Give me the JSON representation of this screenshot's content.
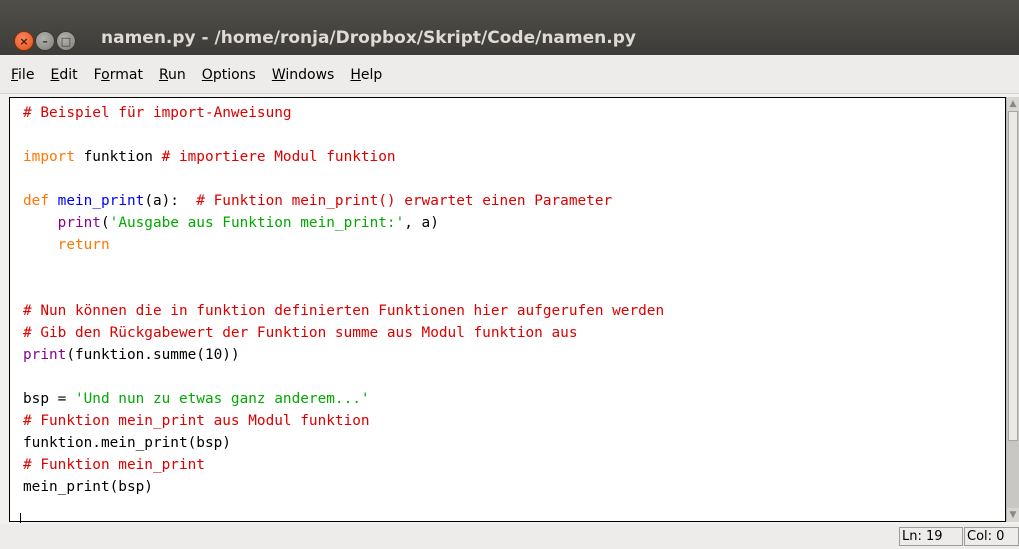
{
  "window": {
    "title": "namen.py - /home/ronja/Dropbox/Skript/Code/namen.py",
    "close_glyph": "×",
    "min_glyph": "–",
    "max_glyph": "□"
  },
  "menubar": {
    "items": [
      {
        "mnemonic": "F",
        "rest": "ile"
      },
      {
        "mnemonic": "E",
        "rest": "dit"
      },
      {
        "pre": "F",
        "mnemonic": "o",
        "rest": "rmat"
      },
      {
        "mnemonic": "R",
        "rest": "un"
      },
      {
        "mnemonic": "O",
        "rest": "ptions"
      },
      {
        "mnemonic": "W",
        "rest": "indows"
      },
      {
        "mnemonic": "H",
        "rest": "elp"
      }
    ]
  },
  "editor": {
    "lines": [
      [
        {
          "t": "comment",
          "s": "# Beispiel für import-Anweisung"
        }
      ],
      [],
      [
        {
          "t": "keyword",
          "s": "import"
        },
        {
          "t": "normal",
          "s": " funktion "
        },
        {
          "t": "comment",
          "s": "# importiere Modul funktion"
        }
      ],
      [],
      [
        {
          "t": "keyword",
          "s": "def"
        },
        {
          "t": "normal",
          "s": " "
        },
        {
          "t": "def",
          "s": "mein_print"
        },
        {
          "t": "normal",
          "s": "(a):  "
        },
        {
          "t": "comment",
          "s": "# Funktion mein_print() erwartet einen Parameter"
        }
      ],
      [
        {
          "t": "normal",
          "s": "    "
        },
        {
          "t": "builtin",
          "s": "print"
        },
        {
          "t": "normal",
          "s": "("
        },
        {
          "t": "string",
          "s": "'Ausgabe aus Funktion mein_print:'"
        },
        {
          "t": "normal",
          "s": ", a)"
        }
      ],
      [
        {
          "t": "normal",
          "s": "    "
        },
        {
          "t": "keyword",
          "s": "return"
        }
      ],
      [],
      [],
      [
        {
          "t": "comment",
          "s": "# Nun können die in funktion definierten Funktionen hier aufgerufen werden"
        }
      ],
      [
        {
          "t": "comment",
          "s": "# Gib den Rückgabewert der Funktion summe aus Modul funktion aus"
        }
      ],
      [
        {
          "t": "builtin",
          "s": "print"
        },
        {
          "t": "normal",
          "s": "(funktion.summe(10))"
        }
      ],
      [],
      [
        {
          "t": "normal",
          "s": "bsp = "
        },
        {
          "t": "string",
          "s": "'Und nun zu etwas ganz anderem...'"
        }
      ],
      [
        {
          "t": "comment",
          "s": "# Funktion mein_print aus Modul funktion"
        }
      ],
      [
        {
          "t": "normal",
          "s": "funktion.mein_print(bsp)"
        }
      ],
      [
        {
          "t": "comment",
          "s": "# Funktion mein_print"
        }
      ],
      [
        {
          "t": "normal",
          "s": "mein_print(bsp)"
        }
      ]
    ]
  },
  "statusbar": {
    "ln": "Ln: 19",
    "col": "Col: 0"
  },
  "colors": {
    "comment": "#dd0000",
    "keyword": "#ff7700",
    "builtin": "#900090",
    "definition": "#0000ff",
    "string": "#00aa00",
    "titlebar": "#3d3c38",
    "close_button": "#e2531b"
  },
  "scroll": {
    "thumb_fraction": 0.83
  }
}
